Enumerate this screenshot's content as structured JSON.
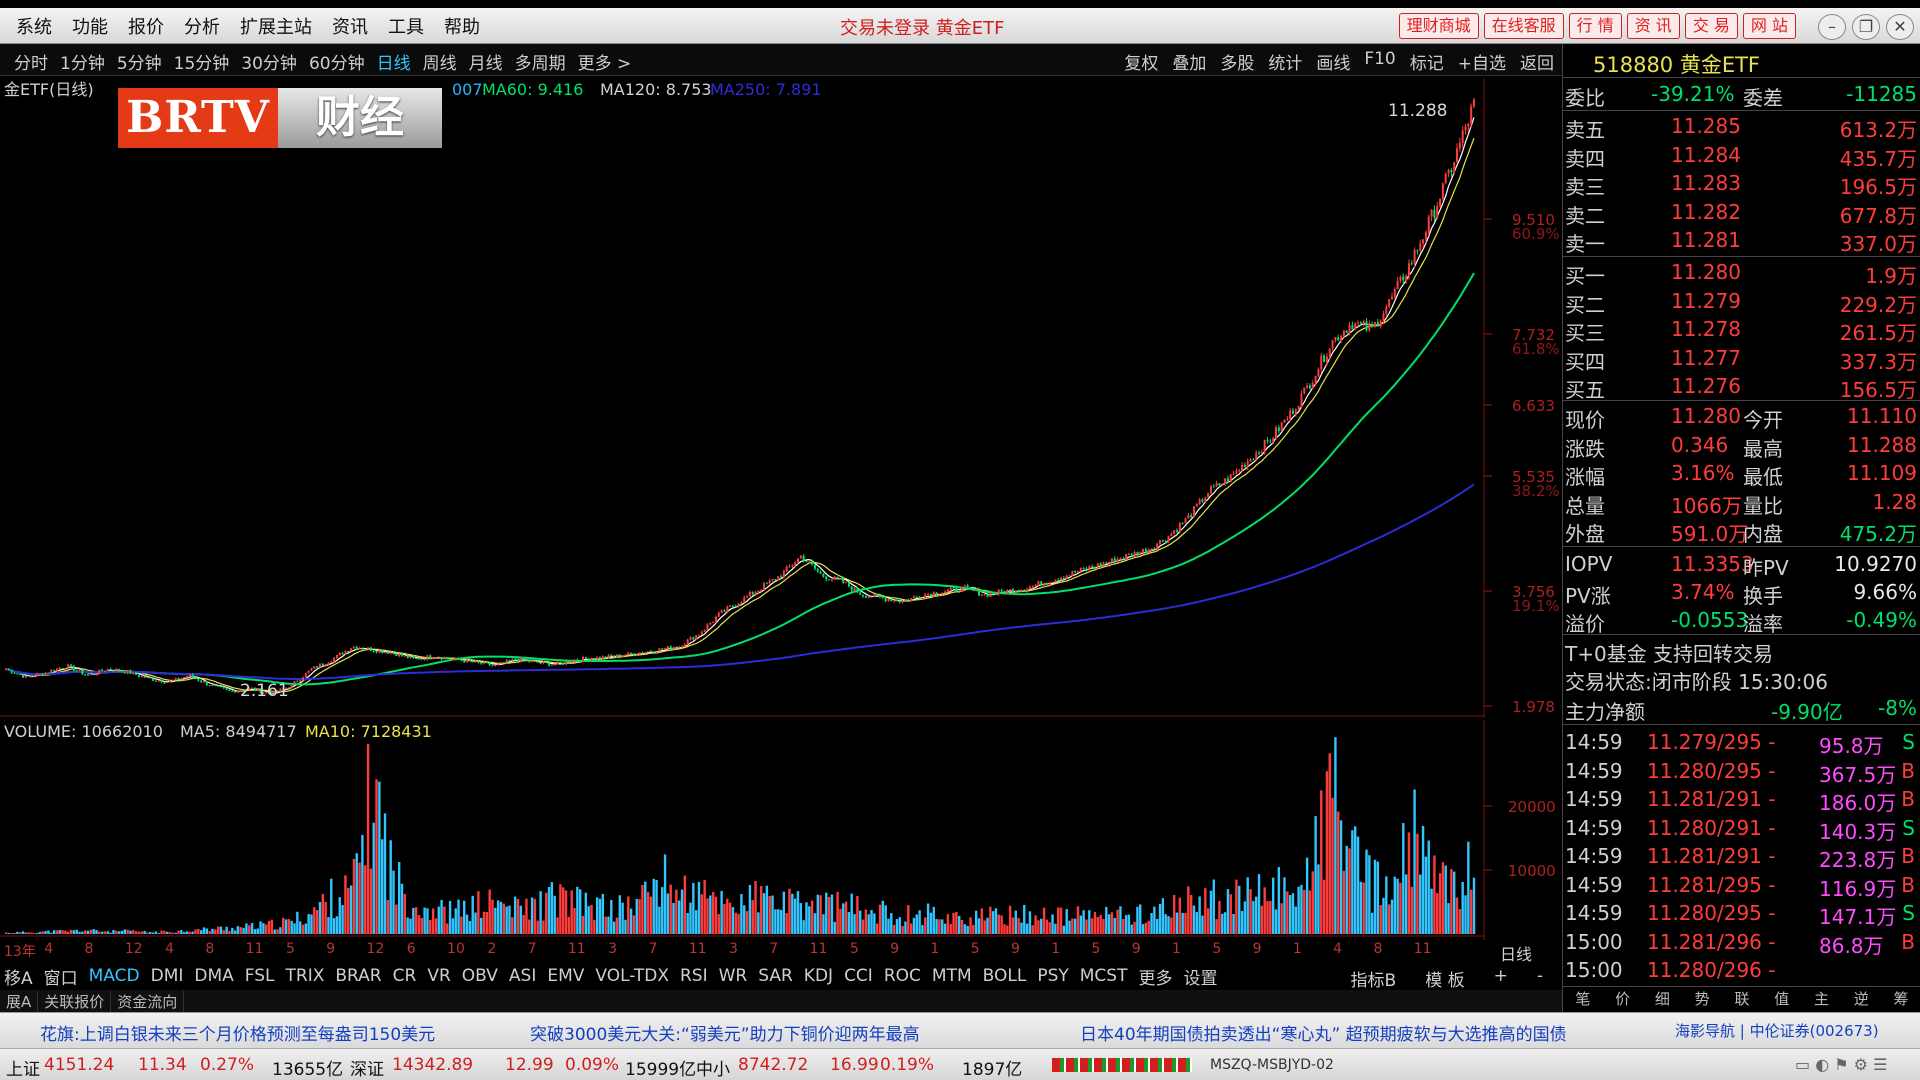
{
  "titlebar": {
    "menus": [
      "系统",
      "功能",
      "报价",
      "分析",
      "扩展主站",
      "资讯",
      "工具",
      "帮助"
    ],
    "title": "交易未登录  黄金ETF",
    "buttons": [
      "理财商城",
      "在线客服",
      "行 情",
      "资 讯",
      "交 易",
      "网 站"
    ]
  },
  "toolbar": {
    "periods": [
      "分时",
      "1分钟",
      "5分钟",
      "15分钟",
      "30分钟",
      "60分钟",
      "日线",
      "周线",
      "月线",
      "多周期",
      "更多 >"
    ],
    "active_period": "日线",
    "tools": [
      "复权",
      "叠加",
      "多股",
      "统计",
      "画线",
      "F10",
      "标记",
      "+自选",
      "返回"
    ]
  },
  "logo": {
    "left": "BRTV",
    "right": "财经"
  },
  "chart_header": {
    "name": "金ETF(日线)",
    "ma60": "MA60: 9.416",
    "ma120": "MA120: 8.753",
    "ma250": "MA250: 7.891",
    "partial": "007"
  },
  "volume_header": {
    "volume": "VOLUME: 10662010",
    "ma5": "MA5: 8494717",
    "ma10": "MA10: 7128431"
  },
  "chart_data": {
    "type": "candlestick",
    "price_axis_labels": [
      "9.510",
      "7.732",
      "6.633",
      "5.535",
      "3.756",
      "1.978"
    ],
    "pct_axis_labels": [
      "60.9%",
      "61.8%",
      "38.2%",
      "19.1%"
    ],
    "high_label": "11.288",
    "low_label": "2.161",
    "ylim": [
      1.978,
      11.288
    ],
    "volume_axis_labels": [
      "20000",
      "10000"
    ],
    "volume_ylim": [
      0,
      30000
    ],
    "price_series": [
      2.55,
      2.42,
      2.5,
      2.6,
      2.45,
      2.55,
      2.5,
      2.4,
      2.35,
      2.45,
      2.3,
      2.2,
      2.25,
      2.161,
      2.3,
      2.55,
      2.7,
      2.9,
      2.85,
      2.8,
      2.7,
      2.75,
      2.7,
      2.65,
      2.6,
      2.7,
      2.65,
      2.62,
      2.7,
      2.72,
      2.75,
      2.8,
      2.85,
      2.9,
      3.1,
      3.4,
      3.6,
      3.8,
      4.0,
      4.3,
      4.0,
      3.9,
      3.7,
      3.65,
      3.6,
      3.7,
      3.75,
      3.8,
      3.7,
      3.75,
      3.8,
      3.9,
      4.0,
      4.1,
      4.2,
      4.3,
      4.4,
      4.6,
      4.9,
      5.3,
      5.5,
      5.8,
      6.1,
      6.5,
      7.0,
      7.6,
      7.9,
      7.8,
      8.3,
      8.9,
      9.6,
      10.4,
      11.288
    ],
    "volume_series": [
      200,
      300,
      400,
      500,
      600,
      400,
      500,
      300,
      400,
      600,
      800,
      1000,
      1200,
      1500,
      2000,
      3500,
      6000,
      7000,
      24000,
      9000,
      5000,
      4000,
      3500,
      4500,
      5000,
      4000,
      4500,
      6000,
      5000,
      4500,
      4000,
      5000,
      9000,
      7000,
      6000,
      5500,
      5000,
      6000,
      5000,
      4500,
      5000,
      4500,
      4000,
      3500,
      3000,
      3500,
      3000,
      2500,
      2800,
      3000,
      3200,
      3000,
      2800,
      3000,
      3200,
      3000,
      3500,
      4000,
      5000,
      6000,
      5500,
      6000,
      7000,
      8000,
      9000,
      25000,
      12000,
      8000,
      7000,
      16000,
      9000,
      8000,
      10662
    ]
  },
  "xaxis_labels": [
    "13年",
    "4",
    "8",
    "12",
    "4",
    "8",
    "11",
    "5",
    "9",
    "12",
    "6",
    "10",
    "2",
    "7",
    "11",
    "3",
    "7",
    "11",
    "3",
    "7",
    "11",
    "5",
    "9",
    "1",
    "5",
    "9",
    "1",
    "5",
    "9",
    "1",
    "5",
    "9",
    "1",
    "4",
    "8",
    "11",
    "日线"
  ],
  "indicators": [
    "移A",
    "窗口",
    "MACD",
    "DMI",
    "DMA",
    "FSL",
    "TRIX",
    "BRAR",
    "CR",
    "VR",
    "OBV",
    "ASI",
    "EMV",
    "VOL-TDX",
    "RSI",
    "WR",
    "SAR",
    "KDJ",
    "CCI",
    "ROC",
    "MTM",
    "BOLL",
    "PSY",
    "MCST",
    "更多",
    "设置"
  ],
  "active_indicator": "MACD",
  "indicator_right": [
    "指标B",
    "模 板",
    "+",
    "-"
  ],
  "bottom_tabs": [
    "展A",
    "关联报价",
    "资金流向"
  ],
  "panel": {
    "header": "518880 黄金ETF",
    "weibi": {
      "label1": "委比",
      "val1": "-39.21%",
      "label2": "委差",
      "val2": "-11285"
    },
    "asks": [
      {
        "label": "卖五",
        "price": "11.285",
        "vol": "613.2万"
      },
      {
        "label": "卖四",
        "price": "11.284",
        "vol": "435.7万"
      },
      {
        "label": "卖三",
        "price": "11.283",
        "vol": "196.5万"
      },
      {
        "label": "卖二",
        "price": "11.282",
        "vol": "677.8万"
      },
      {
        "label": "卖一",
        "price": "11.281",
        "vol": "337.0万"
      }
    ],
    "bids": [
      {
        "label": "买一",
        "price": "11.280",
        "vol": "1.9万"
      },
      {
        "label": "买二",
        "price": "11.279",
        "vol": "229.2万"
      },
      {
        "label": "买三",
        "price": "11.278",
        "vol": "261.5万"
      },
      {
        "label": "买四",
        "price": "11.277",
        "vol": "337.3万"
      },
      {
        "label": "买五",
        "price": "11.276",
        "vol": "156.5万"
      }
    ],
    "quote": [
      {
        "l1": "现价",
        "v1": "11.280",
        "l2": "今开",
        "v2": "11.110"
      },
      {
        "l1": "涨跌",
        "v1": "0.346",
        "l2": "最高",
        "v2": "11.288"
      },
      {
        "l1": "涨幅",
        "v1": "3.16%",
        "l2": "最低",
        "v2": "11.109"
      },
      {
        "l1": "总量",
        "v1": "1066万",
        "l2": "量比",
        "v2": "1.28"
      },
      {
        "l1": "外盘",
        "v1": "591.0万",
        "l2": "内盘",
        "v2": "475.2万"
      }
    ],
    "iopv": [
      {
        "l1": "IOPV",
        "v1": "11.3353",
        "l2": "昨PV",
        "v2": "10.9270"
      },
      {
        "l1": "PV涨",
        "v1": "3.74%",
        "l2": "换手",
        "v2": "9.66%"
      },
      {
        "l1": "溢价",
        "v1": "-0.0553",
        "l2": "溢率",
        "v2": "-0.49%"
      }
    ],
    "t0": "T+0基金 支持回转交易",
    "trade_status": "交易状态:闭市阶段 15:30:06",
    "main_flow": {
      "label": "主力净额",
      "val": "-9.90亿",
      "pct": "-8%"
    },
    "ticks": [
      {
        "t": "14:59",
        "p": "11.279/295 -",
        "v": "95.8万",
        "s": "S"
      },
      {
        "t": "14:59",
        "p": "11.280/295 -",
        "v": "367.5万",
        "s": "B"
      },
      {
        "t": "14:59",
        "p": "11.281/291 -",
        "v": "186.0万",
        "s": "B"
      },
      {
        "t": "14:59",
        "p": "11.280/291 -",
        "v": "140.3万",
        "s": "S"
      },
      {
        "t": "14:59",
        "p": "11.281/291 -",
        "v": "223.8万",
        "s": "B"
      },
      {
        "t": "14:59",
        "p": "11.281/295 -",
        "v": "116.9万",
        "s": "B"
      },
      {
        "t": "14:59",
        "p": "11.280/295 -",
        "v": "147.1万",
        "s": "S"
      },
      {
        "t": "15:00",
        "p": "11.281/296 -",
        "v": "86.8万",
        "s": "B"
      },
      {
        "t": "15:00",
        "p": "11.280/296 -",
        "v": "",
        "s": ""
      }
    ],
    "footer_tabs": [
      "笔",
      "价",
      "细",
      "势",
      "联",
      "值",
      "主",
      "逆",
      "筹"
    ]
  },
  "ticker": {
    "items": [
      "花旗:上调白银未来三个月价格预测至每盎司150美元",
      "突破3000美元大关:“弱美元”助力下铜价迎两年最高",
      "日本40年期国债拍卖透出“寒心丸” 超预期疲软与大选推高的国债"
    ],
    "right": "海影导航 | 中伦证券(002673)"
  },
  "status": {
    "sh": {
      "name": "上证",
      "val": "4151.24",
      "chg": "11.34",
      "pct": "0.27%",
      "amt": "13655亿"
    },
    "sz": {
      "name": "深证",
      "val": "14342.89",
      "chg": "12.99",
      "pct": "0.09%",
      "amt": "15999亿"
    },
    "zx": {
      "name": "中小",
      "val": "8742.72",
      "chg": "16.99",
      "pct": "0.19%",
      "amt": "1897亿"
    },
    "server": "MSZQ-MSBJYD-02"
  },
  "colors": {
    "up": "#ff3c3c",
    "down": "#00e06a",
    "cyan": "#32c6ff",
    "ma5": "#ffffff",
    "ma10": "#e8e24c",
    "ma60": "#00e06a",
    "ma250": "#2c2cd8"
  }
}
